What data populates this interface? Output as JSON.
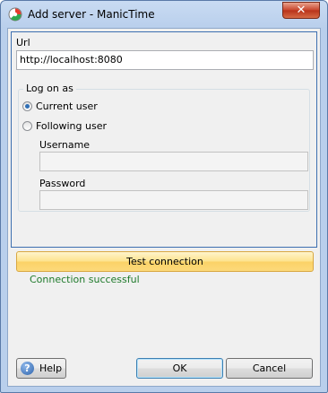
{
  "window": {
    "title": "Add server - ManicTime",
    "close_label": "✕"
  },
  "url": {
    "label": "Url",
    "value": "http://localhost:8080"
  },
  "logon": {
    "title": "Log on as",
    "options": [
      {
        "label": "Current user",
        "checked": true
      },
      {
        "label": "Following user",
        "checked": false
      }
    ],
    "username_label": "Username",
    "username_value": "",
    "password_label": "Password",
    "password_value": ""
  },
  "test": {
    "button_label": "Test connection",
    "status": "Connection successful",
    "status_color": "#1f7a2b"
  },
  "footer": {
    "help_label": "Help",
    "help_icon": "?",
    "ok_label": "OK",
    "cancel_label": "Cancel"
  },
  "colors": {
    "accent": "#3d6fb0",
    "test_button": "#fbd267"
  }
}
